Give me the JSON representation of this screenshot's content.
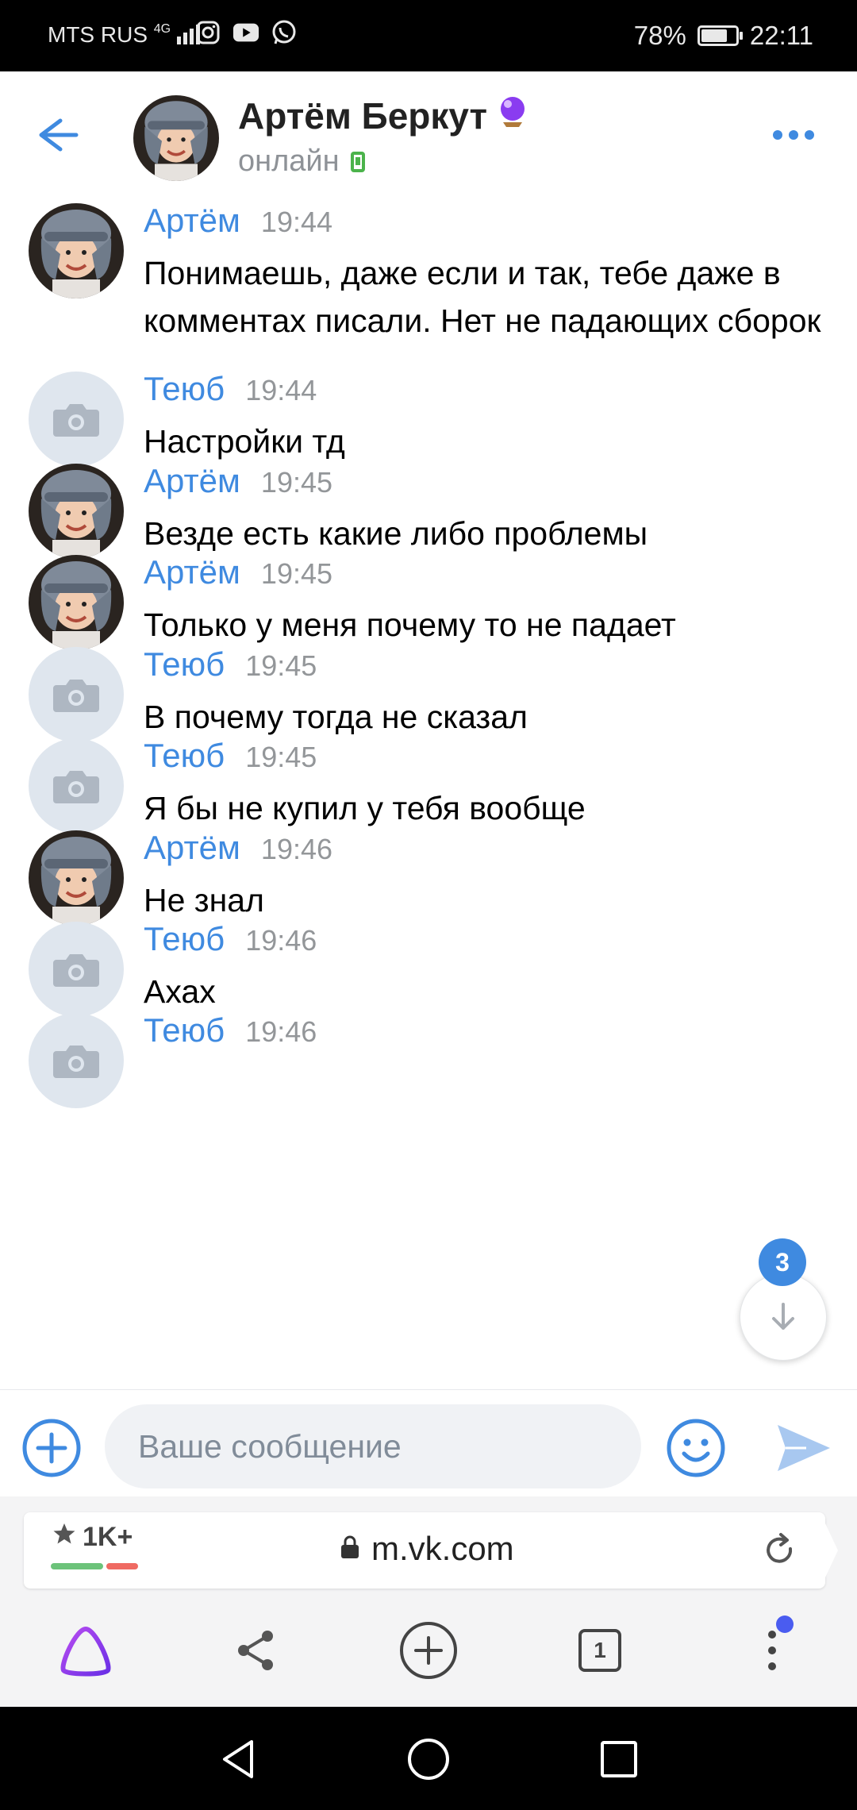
{
  "status_bar": {
    "carrier": "MTS RUS",
    "network": "4G",
    "battery": "78%",
    "time": "22:11",
    "app_icons": [
      "instagram-icon",
      "youtube-icon",
      "whatsapp-icon"
    ]
  },
  "header": {
    "name": "Артём Беркут",
    "status": "онлайн"
  },
  "messages": [
    {
      "author": "Артём",
      "time": "19:44",
      "text": "Понимаешь, даже если и так, тебе даже в комментах писали. Нет не падающих сборок",
      "avatar": "photo"
    },
    {
      "author": "Теюб",
      "time": "19:44",
      "text": "Настройки тд",
      "avatar": "camera"
    },
    {
      "author": "Артём",
      "time": "19:45",
      "text": "Везде есть какие либо проблемы",
      "avatar": "photo"
    },
    {
      "author": "Артём",
      "time": "19:45",
      "text": "Только у меня почему то не падает",
      "avatar": "photo"
    },
    {
      "author": "Теюб",
      "time": "19:45",
      "text": "В почему тогда не сказал",
      "avatar": "camera"
    },
    {
      "author": "Теюб",
      "time": "19:45",
      "text": "Я бы не купил у тебя вообще",
      "avatar": "camera"
    },
    {
      "author": "Артём",
      "time": "19:46",
      "text": "Не знал",
      "avatar": "photo"
    },
    {
      "author": "Теюб",
      "time": "19:46",
      "text": "Ахах",
      "avatar": "camera"
    },
    {
      "author": "Теюб",
      "time": "19:46",
      "text": "",
      "avatar": "camera"
    }
  ],
  "scroll_down": {
    "unread_count": "3"
  },
  "composer": {
    "placeholder": "Ваше сообщение"
  },
  "browser": {
    "rating": "1K+",
    "url": "m.vk.com",
    "tab_count": "1"
  },
  "colors": {
    "accent": "#3f8ae0",
    "online": "#4bb34b",
    "alice": "#8a3cf0"
  }
}
